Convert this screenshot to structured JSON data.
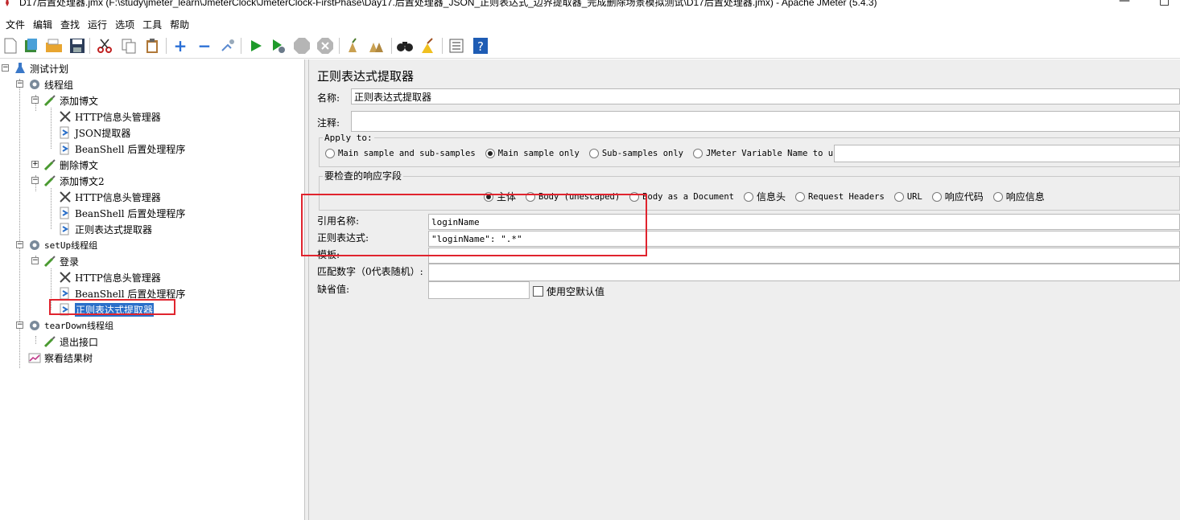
{
  "window": {
    "title": "D17后置处理器.jmx (F:\\study\\jmeter_learn\\JmeterClock\\JmeterClock-FirstPhase\\Day17.后置处理器_JSON_正则表达式_边界提取器_完成删除场景模拟测试\\D17后置处理器.jmx) - Apache JMeter (5.4.3)",
    "minimize": "—",
    "maximize": "□"
  },
  "menu": [
    "文件",
    "编辑",
    "查找",
    "运行",
    "选项",
    "工具",
    "帮助"
  ],
  "tree": {
    "items": [
      {
        "label": "测试计划",
        "icon": "flask-icon"
      },
      {
        "label": "线程组",
        "icon": "gear-icon"
      },
      {
        "label": "添加博文",
        "icon": "pipette-icon"
      },
      {
        "label": "HTTP信息头管理器",
        "icon": "tools-icon"
      },
      {
        "label": "JSON提取器",
        "icon": "arrow-icon"
      },
      {
        "label": "BeanShell 后置处理程序",
        "icon": "arrow-icon"
      },
      {
        "label": "删除博文",
        "icon": "pipette-icon"
      },
      {
        "label": "添加博文2",
        "icon": "pipette-icon"
      },
      {
        "label": "HTTP信息头管理器",
        "icon": "tools-icon"
      },
      {
        "label": "BeanShell 后置处理程序",
        "icon": "arrow-icon"
      },
      {
        "label": "正则表达式提取器",
        "icon": "arrow-icon"
      },
      {
        "label": "setUp线程组",
        "icon": "gear-icon"
      },
      {
        "label": "登录",
        "icon": "pipette-icon"
      },
      {
        "label": "HTTP信息头管理器",
        "icon": "tools-icon"
      },
      {
        "label": "BeanShell 后置处理程序",
        "icon": "arrow-icon"
      },
      {
        "label": "正则表达式提取器",
        "icon": "arrow-icon",
        "selected": true
      },
      {
        "label": "tearDown线程组",
        "icon": "gear-icon"
      },
      {
        "label": "退出接口",
        "icon": "pipette-icon"
      },
      {
        "label": "察看结果树",
        "icon": "chart-icon"
      }
    ]
  },
  "panel": {
    "title": "正则表达式提取器",
    "name_label": "名称:",
    "name_value": "正则表达式提取器",
    "comment_label": "注释:",
    "comment_value": "",
    "apply_to": {
      "legend": "Apply to:",
      "options": [
        "Main sample and sub-samples",
        "Main sample only",
        "Sub-samples only",
        "JMeter Variable Name to use"
      ],
      "selected": "Main sample only"
    },
    "response_field": {
      "legend": "要检查的响应字段",
      "options": [
        "主体",
        "Body (unescaped)",
        "Body as a Document",
        "信息头",
        "Request Headers",
        "URL",
        "响应代码",
        "响应信息"
      ],
      "selected": "主体"
    },
    "ref_name_label": "引用名称:",
    "ref_name_value": "loginName",
    "regex_label": "正则表达式:",
    "regex_value": "\"loginName\": \".*\"",
    "template_label": "模板:",
    "template_value": "",
    "match_no_label": "匹配数字（0代表随机）:",
    "match_no_value": "",
    "default_label": "缺省值:",
    "default_value": "",
    "use_empty_label": "使用空默认值"
  }
}
